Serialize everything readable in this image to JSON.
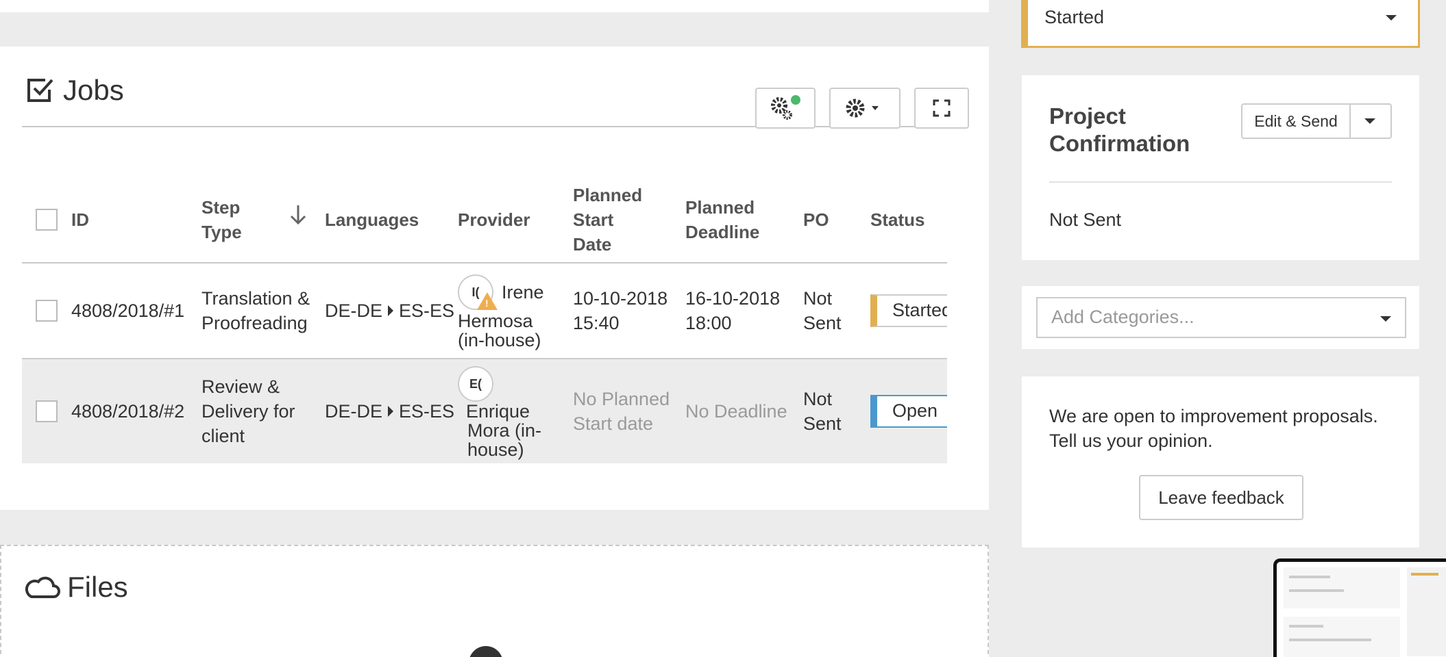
{
  "jobs": {
    "title": "Jobs",
    "columns": {
      "id": "ID",
      "step_type": "Step Type",
      "languages": "Languages",
      "provider": "Provider",
      "planned_start": "Planned Start Date",
      "planned_deadline": "Planned Deadline",
      "po": "PO",
      "status": "Status"
    },
    "rows": [
      {
        "id": "4808/2018/#1",
        "step_type": "Translation & Proofreading",
        "source_lang": "DE-DE",
        "target_lang": "ES-ES",
        "provider_initials": "I(",
        "provider_name": "Irene",
        "provider_name_rest": "Hermosa (in-house)",
        "start": "10-10-2018 15:40",
        "deadline": "16-10-2018 18:00",
        "po": "Not Sent",
        "status": "Started"
      },
      {
        "id": "4808/2018/#2",
        "step_type": "Review & Delivery for client",
        "source_lang": "DE-DE",
        "target_lang": "ES-ES",
        "provider_initials": "E(",
        "provider_name": "Enrique Mora (in-house)",
        "start": "No Planned Start date",
        "deadline": "No Deadline",
        "po": "Not Sent",
        "status": "Open"
      }
    ]
  },
  "files": {
    "title": "Files"
  },
  "project_status": {
    "value": "Started"
  },
  "confirmation": {
    "title": "Project Confirmation",
    "action_label": "Edit & Send",
    "status": "Not Sent"
  },
  "categories": {
    "placeholder": "Add Categories..."
  },
  "feedback": {
    "text": "We are open to improvement proposals. Tell us your opinion.",
    "button_label": "Leave feedback"
  },
  "colors": {
    "started": "#e0b050",
    "open": "#4a98cf",
    "online_dot": "#4cb86a",
    "warning": "#f0ad4e"
  }
}
